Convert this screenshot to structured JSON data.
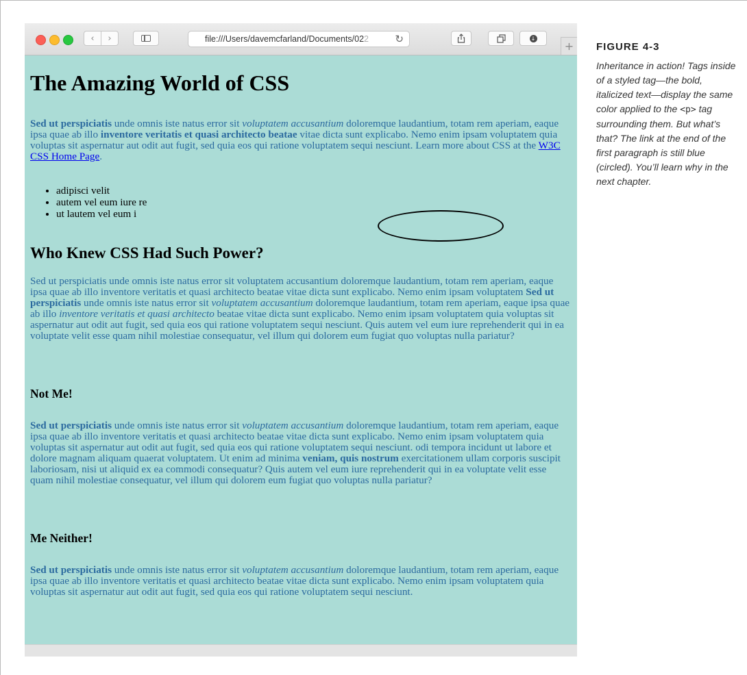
{
  "browser": {
    "address_text": "file:///Users/davemcfarland/Documents/02",
    "address_fade": "2",
    "reload_icon": "↻",
    "newtab_label": "+",
    "back_label": "‹",
    "forward_label": "›"
  },
  "page": {
    "title": "The Amazing World of CSS",
    "p1": {
      "bold1": "Sed ut perspiciatis",
      "t1": " unde omnis iste natus error sit ",
      "italic1": "voluptatem accusantium",
      "t2": " doloremque laudantium, totam rem aperiam, eaque ipsa quae ab illo ",
      "bold2": "inventore veritatis et quasi architecto beatae",
      "t3": " vitae dicta sunt explicabo. Nemo enim ipsam voluptatem quia voluptas sit aspernatur aut odit aut fugit, sed quia eos qui ratione voluptatem sequi nesciunt. Learn more about CSS at the ",
      "link": "W3C CSS Home Page",
      "t4": "."
    },
    "list": [
      "adipisci velit",
      "autem vel eum iure re",
      "ut lautem vel eum i"
    ],
    "h2": "Who Knew CSS Had Such Power?",
    "p2": {
      "t1": "Sed ut perspiciatis unde omnis iste natus error sit voluptatem accusantium doloremque laudantium, totam rem aperiam, eaque ipsa quae ab illo inventore veritatis et quasi architecto beatae vitae dicta sunt explicabo. Nemo enim ipsam voluptatem ",
      "bold1": "Sed ut perspiciatis",
      "t2": " unde omnis iste natus error sit ",
      "italic1": "voluptatem accusantium",
      "t3": " doloremque laudantium, totam rem aperiam, eaque ipsa quae ab illo ",
      "italic2": "inventore veritatis et quasi architecto",
      "t4": " beatae vitae dicta sunt explicabo. Nemo enim ipsam voluptatem quia voluptas sit aspernatur aut odit aut fugit, sed quia eos qui ratione voluptatem sequi nesciunt. Quis autem vel eum iure reprehenderit qui in ea voluptate velit esse quam nihil molestiae consequatur, vel illum qui dolorem eum fugiat quo voluptas nulla pariatur?"
    },
    "h3a": "Not Me!",
    "p3": {
      "bold1": "Sed ut perspiciatis",
      "t1": " unde omnis iste natus error sit ",
      "italic1": "voluptatem accusantium",
      "t2": " doloremque laudantium, totam rem aperiam, eaque ipsa quae ab illo inventore veritatis et quasi architecto beatae vitae dicta sunt explicabo. Nemo enim ipsam voluptatem quia voluptas sit aspernatur aut odit aut fugit, sed quia eos qui ratione voluptatem sequi nesciunt. odi tempora incidunt ut labore et dolore magnam aliquam quaerat voluptatem. Ut enim ad minima ",
      "bold2": "veniam, quis nostrum",
      "t3": " exercitationem ullam corporis suscipit laboriosam, nisi ut aliquid ex ea commodi consequatur? Quis autem vel eum iure reprehenderit qui in ea voluptate velit esse quam nihil molestiae consequatur, vel illum qui dolorem eum fugiat quo voluptas nulla pariatur?"
    },
    "h3b": "Me Neither!",
    "p4": {
      "bold1": "Sed ut perspiciatis",
      "t1": " unde omnis iste natus error sit ",
      "italic1": "voluptatem accusantium",
      "t2": " doloremque laudantium, totam rem aperiam, eaque ipsa quae ab illo inventore veritatis et quasi architecto beatae vitae dicta sunt explicabo. Nemo enim ipsam voluptatem quia voluptas sit aspernatur aut odit aut fugit, sed quia eos qui ratione voluptatem sequi nesciunt."
    }
  },
  "caption": {
    "label": "FIGURE 4-3",
    "t1": "Inheritance in action! Tags inside of a styled tag—the bold, italicized text—display the same color applied to the ",
    "code": "<p>",
    "t2": " tag surrounding them. But what’s that? The link at the end of the first paragraph is still blue (circled). You’ll learn why in the next chapter."
  },
  "colors": {
    "page_background": "#abdcd6",
    "body_text": "#2b6a9f",
    "link": "#0000ee"
  }
}
